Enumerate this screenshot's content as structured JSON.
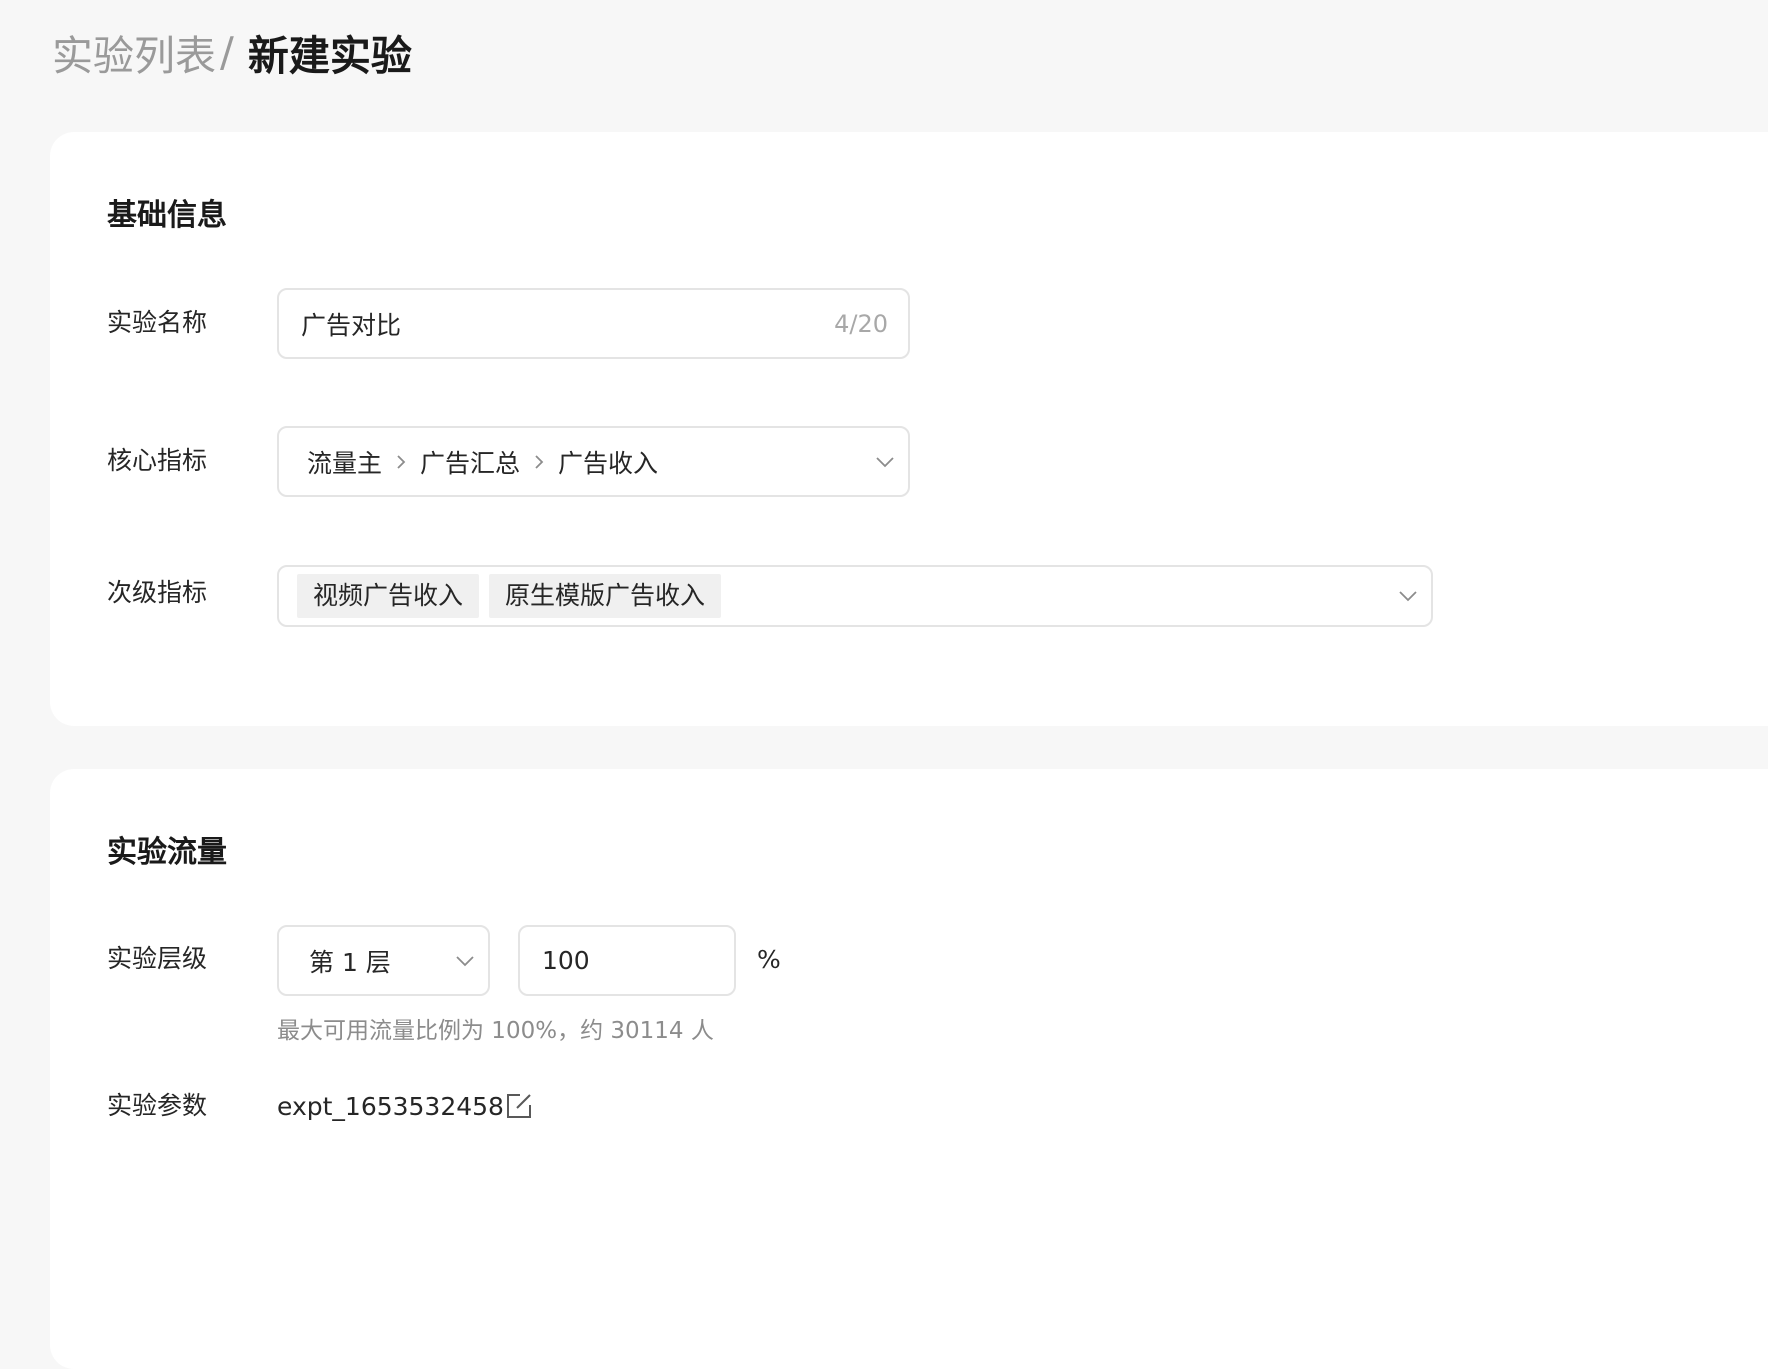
{
  "breadcrumb": {
    "parent": "实验列表",
    "separator": "/",
    "current": "新建实验"
  },
  "basic_info": {
    "title": "基础信息",
    "name": {
      "label": "实验名称",
      "value": "广告对比",
      "counter": "4/20"
    },
    "core_metric": {
      "label": "核心指标",
      "path": [
        "流量主",
        "广告汇总",
        "广告收入"
      ],
      "icon": "chevron-down-icon"
    },
    "secondary_metrics": {
      "label": "次级指标",
      "tags": [
        "视频广告收入",
        "原生模版广告收入"
      ],
      "icon": "chevron-down-icon"
    }
  },
  "traffic": {
    "title": "实验流量",
    "layer": {
      "label": "实验层级",
      "selected": "第 1 层",
      "percent_value": "100",
      "unit": "%",
      "hint": "最大可用流量比例为 100%，约 30114 人"
    },
    "param": {
      "label": "实验参数",
      "value": "expt_1653532458",
      "icon": "edit-icon"
    }
  },
  "colors": {
    "page_bg": "#f7f7f7",
    "card_bg": "#ffffff",
    "border": "#e4e4e4",
    "muted_text": "#9a9a9a",
    "tag_bg": "#f0f0f0"
  }
}
